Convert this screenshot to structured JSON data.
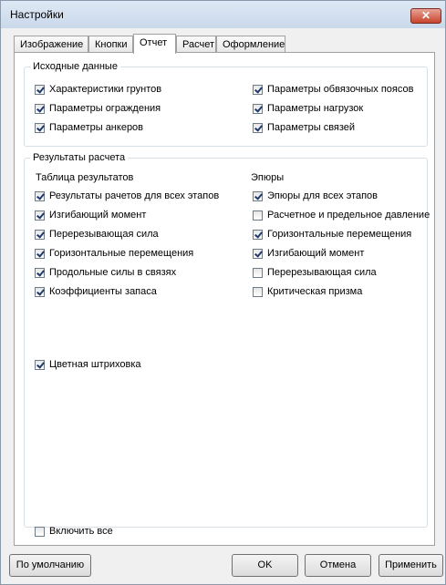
{
  "window": {
    "title": "Настройки",
    "close_label": "✕"
  },
  "tabs": [
    "Изображение",
    "Кнопки",
    "Отчет",
    "Расчет",
    "Оформление"
  ],
  "active_tab": "Отчет",
  "source_data": {
    "legend": "Исходные данные",
    "left": [
      {
        "label": "Характеристики грунтов",
        "checked": true
      },
      {
        "label": "Параметры ограждения",
        "checked": true
      },
      {
        "label": "Параметры анкеров",
        "checked": true
      }
    ],
    "right": [
      {
        "label": "Параметры обвязочных поясов",
        "checked": true
      },
      {
        "label": "Параметры нагрузок",
        "checked": true
      },
      {
        "label": "Параметры связей",
        "checked": true
      }
    ]
  },
  "results": {
    "legend": "Результаты расчета",
    "table_heading": "Таблица результатов",
    "diagrams_heading": "Эпюры",
    "table_items": [
      {
        "label": "Результаты рачетов для всех этапов",
        "checked": true
      },
      {
        "label": "Изгибающий момент",
        "checked": true
      },
      {
        "label": "Перерезывающая сила",
        "checked": true
      },
      {
        "label": "Горизонтальные перемещения",
        "checked": true
      },
      {
        "label": "Продольные силы в связях",
        "checked": true
      },
      {
        "label": "Коэффициенты запаса",
        "checked": true
      }
    ],
    "diagram_items": [
      {
        "label": "Эпюры для всех этапов",
        "checked": true
      },
      {
        "label": "Расчетное и предельное давление",
        "checked": false
      },
      {
        "label": "Горизонтальные перемещения",
        "checked": true
      },
      {
        "label": "Изгибающий момент",
        "checked": true
      },
      {
        "label": "Перерезывающая сила",
        "checked": false
      },
      {
        "label": "Критическая призма",
        "checked": false
      }
    ],
    "color_hatching": {
      "label": "Цветная штриховка",
      "checked": true
    }
  },
  "enable_all": {
    "label": "Включить все",
    "checked": false
  },
  "buttons": {
    "default": "По умолчанию",
    "ok": "OK",
    "cancel": "Отмена",
    "apply": "Применить"
  }
}
